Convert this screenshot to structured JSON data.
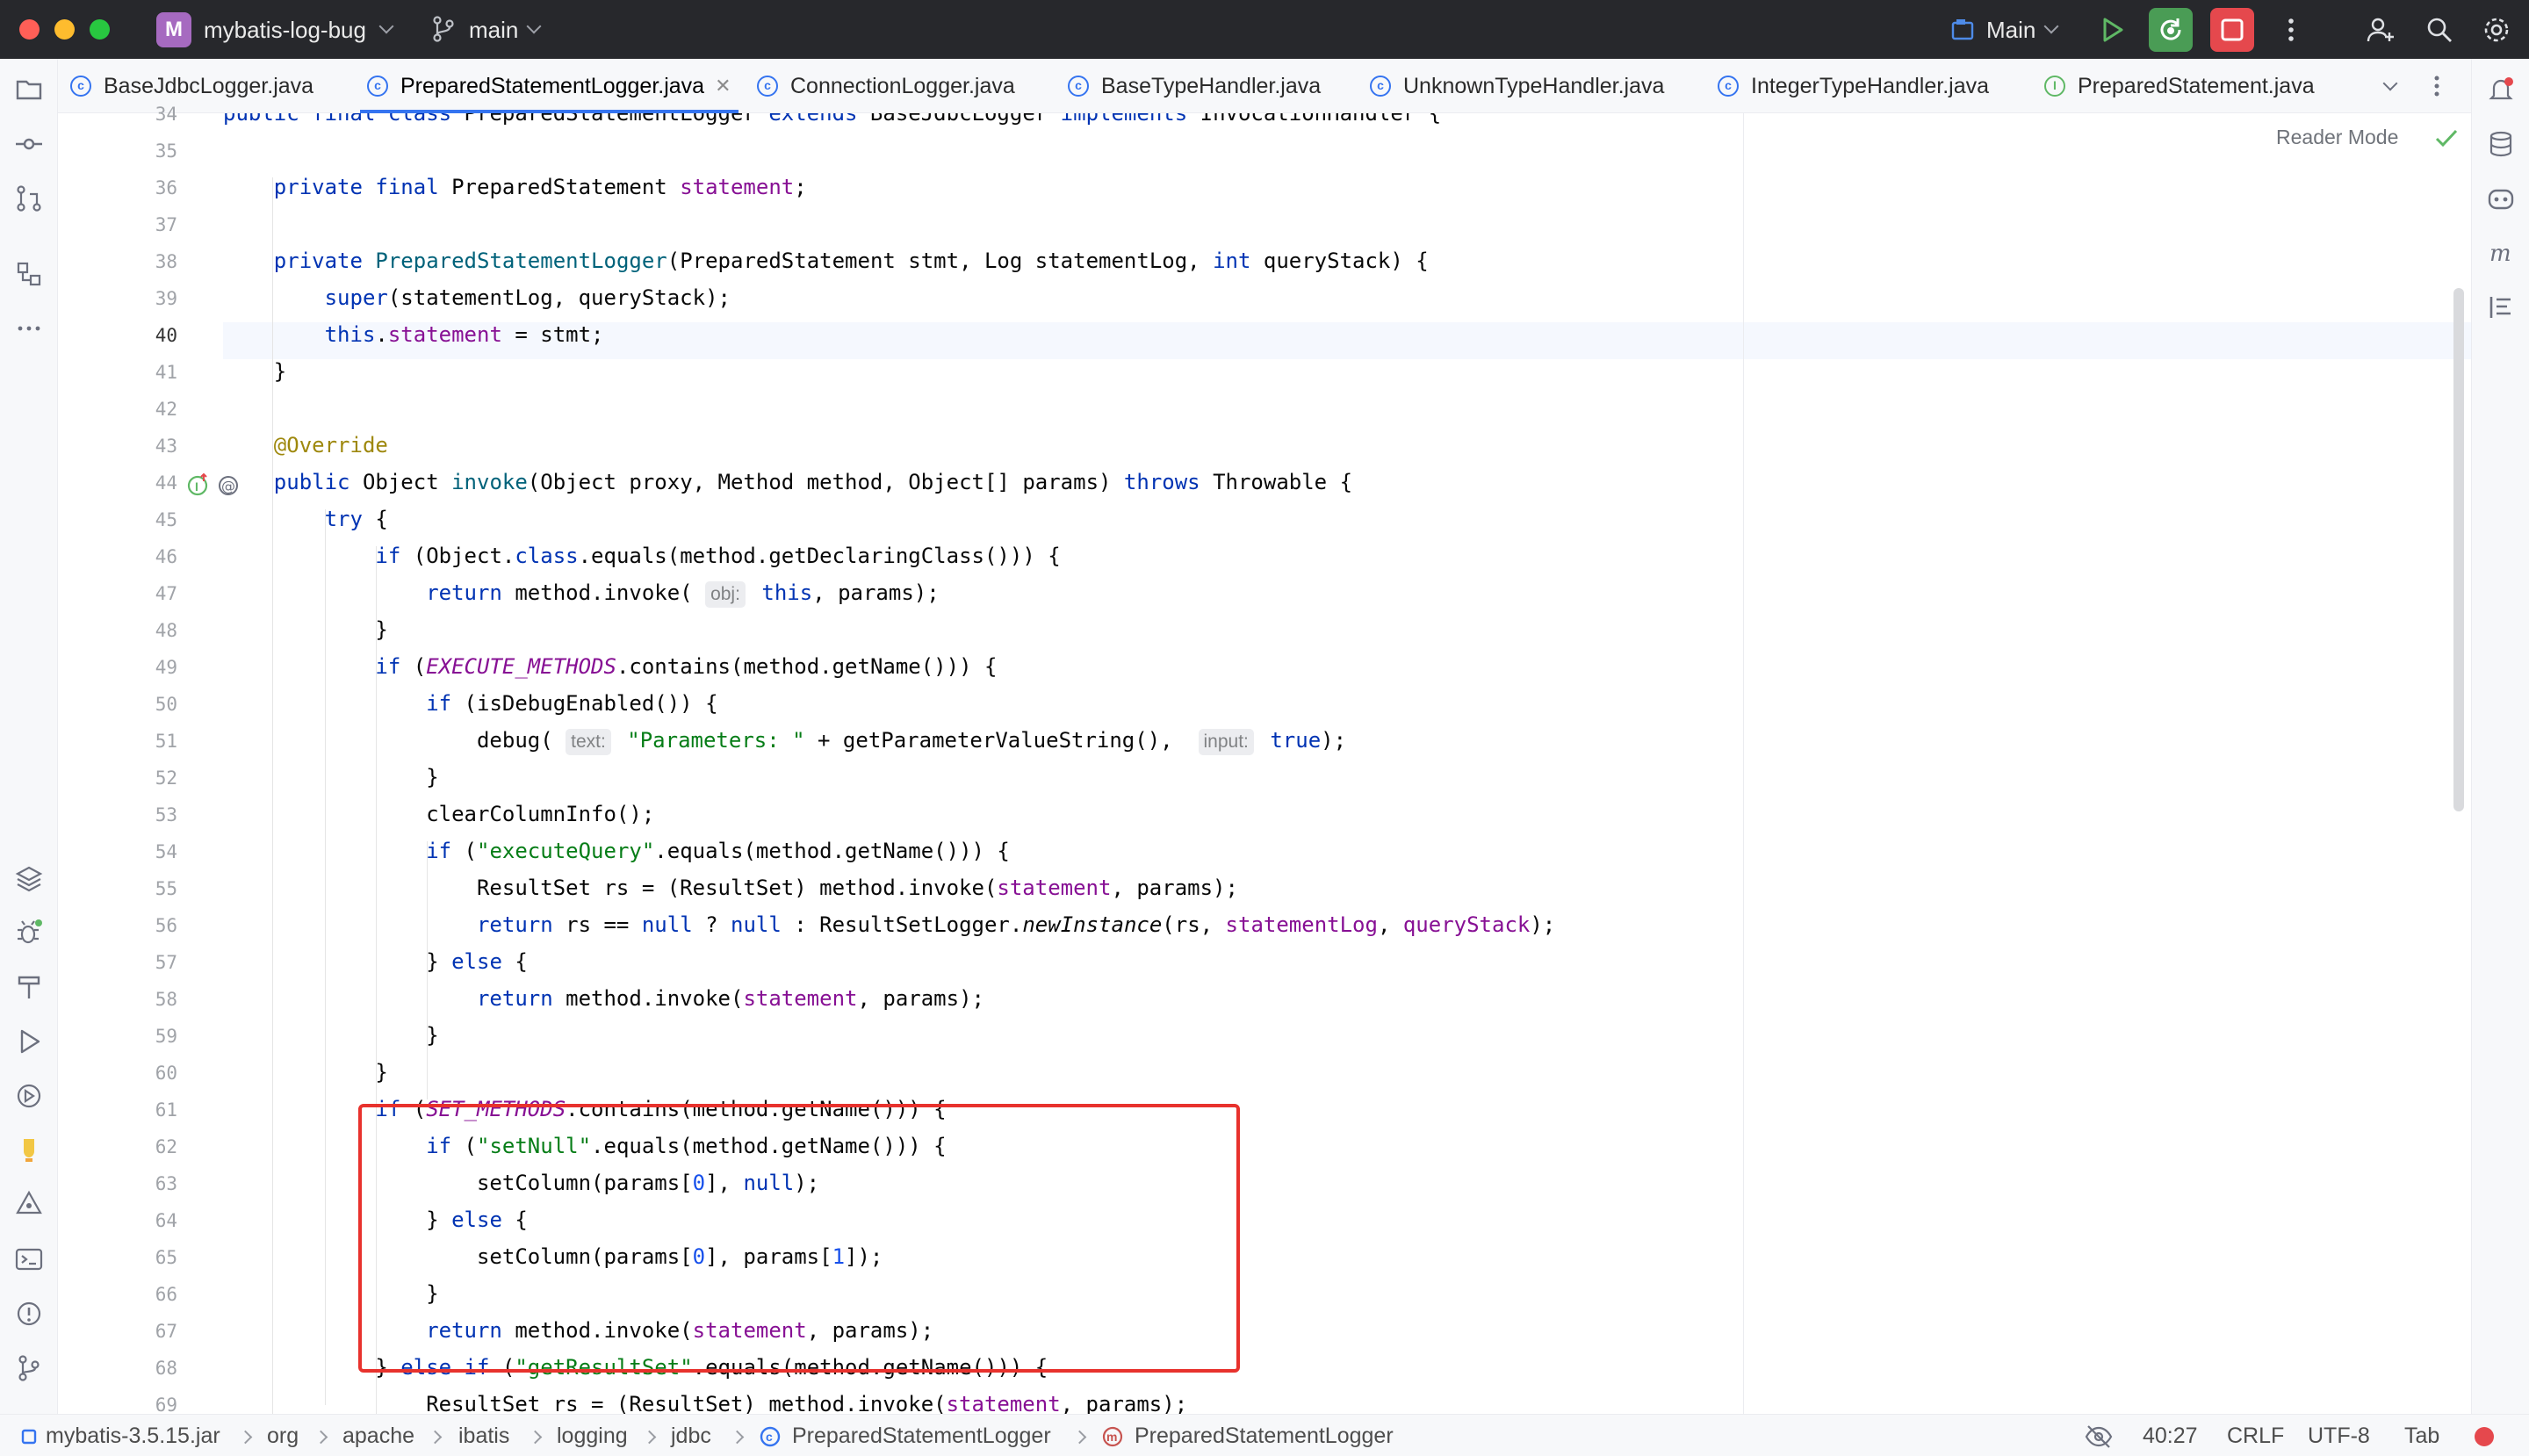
{
  "window": {
    "project_badge": "M",
    "project_name": "mybatis-log-bug",
    "branch": "main",
    "run_config": "Main"
  },
  "tabs": [
    {
      "label": "BaseJdbcLogger.java",
      "icon": "class-icon"
    },
    {
      "label": "PreparedStatementLogger.java",
      "icon": "class-icon",
      "active": true
    },
    {
      "label": "ConnectionLogger.java",
      "icon": "class-icon"
    },
    {
      "label": "BaseTypeHandler.java",
      "icon": "class-icon"
    },
    {
      "label": "UnknownTypeHandler.java",
      "icon": "class-icon"
    },
    {
      "label": "IntegerTypeHandler.java",
      "icon": "class-icon"
    },
    {
      "label": "PreparedStatement.java",
      "icon": "interface-icon"
    }
  ],
  "editor": {
    "reader_mode": "Reader Mode",
    "line_numbers": [
      "34",
      "35",
      "36",
      "37",
      "38",
      "39",
      "40",
      "41",
      "42",
      "43",
      "44",
      "45",
      "46",
      "47",
      "48",
      "49",
      "50",
      "51",
      "52",
      "53",
      "54",
      "55",
      "56",
      "57",
      "58",
      "59",
      "60",
      "61",
      "62",
      "63",
      "64",
      "65",
      "66",
      "67",
      "68",
      "69"
    ],
    "current_line": "40",
    "gutter_icons": [
      "implements-method-icon",
      "annotation-at-icon"
    ]
  },
  "status": {
    "crumbs": [
      "mybatis-3.5.15.jar",
      "org",
      "apache",
      "ibatis",
      "logging",
      "jdbc",
      "PreparedStatementLogger",
      "PreparedStatementLogger"
    ],
    "position": "40:27",
    "line_sep": "CRLF",
    "encoding": "UTF-8",
    "indent": "Tab"
  },
  "colors": {
    "accent": "#3574f0",
    "highlight_box": "#e8322d",
    "run_green": "#4caf50",
    "stop_red": "#e5484d"
  }
}
